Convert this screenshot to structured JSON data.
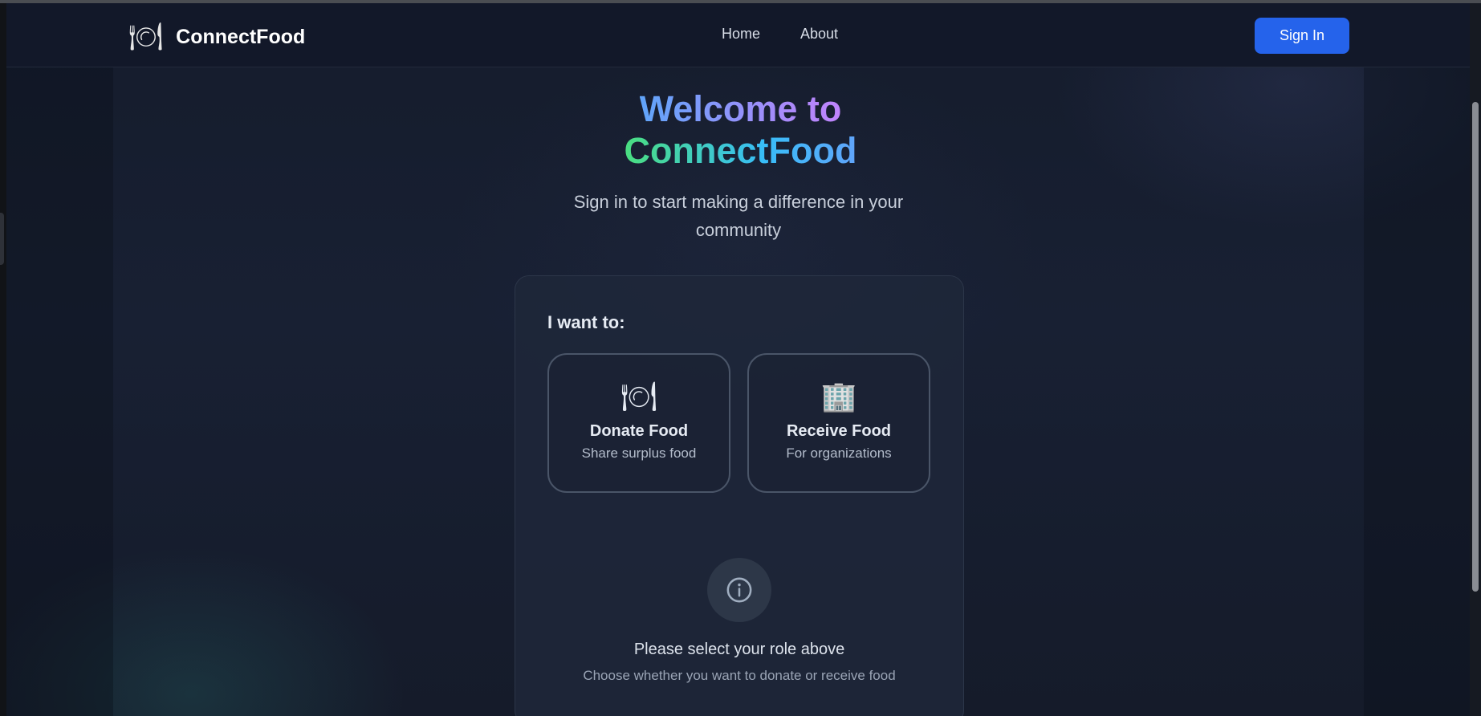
{
  "navbar": {
    "brand_icon": "🍽",
    "brand_name": "ConnectFood",
    "links": [
      {
        "label": "Home"
      },
      {
        "label": "About"
      }
    ],
    "signin_label": "Sign In"
  },
  "hero": {
    "line1": "Welcome to",
    "line2": "ConnectFood",
    "subtitle": "Sign in to start making a difference in your community"
  },
  "card": {
    "prompt": "I want to:",
    "roles": [
      {
        "icon": "🍽",
        "title": "Donate Food",
        "description": "Share surplus food"
      },
      {
        "icon": "🏢",
        "title": "Receive Food",
        "description": "For organizations"
      }
    ],
    "info_icon": "info-icon",
    "info_title": "Please select your role above",
    "info_subtitle": "Choose whether you want to donate or receive food"
  },
  "colors": {
    "accent": "#2563eb",
    "background": "#141a28"
  }
}
